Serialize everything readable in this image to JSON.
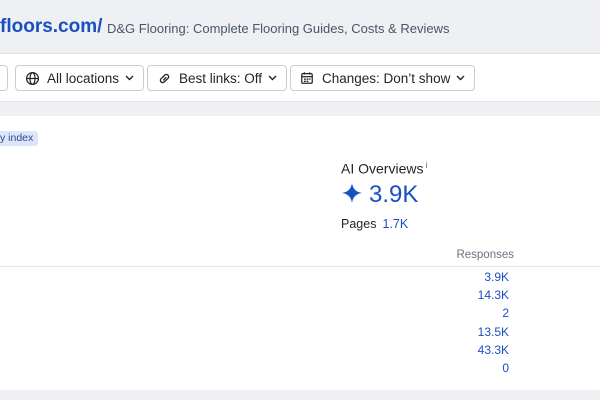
{
  "header": {
    "site_url": "floors.com/",
    "site_title": "D&G Flooring: Complete Flooring Guides, Costs & Reviews"
  },
  "toolbar": {
    "locations_label": "All locations",
    "best_links_label": "Best links: Off",
    "changes_label": "Changes: Don’t show"
  },
  "card": {
    "tag_label": "y index",
    "ai_overviews": {
      "title": "AI Overviews",
      "info_mark": "i",
      "value": "3.9K",
      "pages_label": "Pages",
      "pages_value": "1.7K"
    },
    "responses_header": "Responses",
    "responses": [
      "3.9K",
      "14.3K",
      "2",
      "13.5K",
      "43.3K",
      "0"
    ]
  },
  "colors": {
    "accent": "#1a4fc2",
    "background": "#eef0f3"
  }
}
